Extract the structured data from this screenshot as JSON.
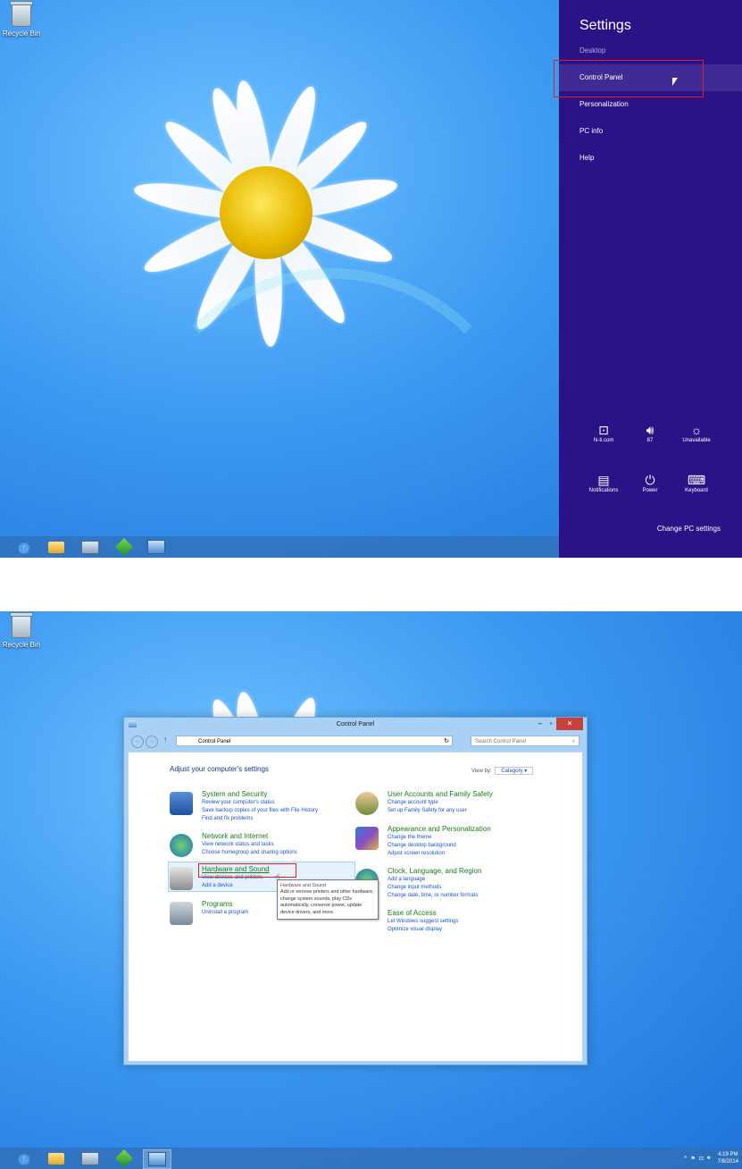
{
  "desktop": {
    "recycle_bin_label": "Recycle Bin"
  },
  "charms": {
    "title": "Settings",
    "items": [
      {
        "label": "Desktop",
        "dim": true
      },
      {
        "label": "Control Panel"
      },
      {
        "label": "Personalization"
      },
      {
        "label": "PC info"
      },
      {
        "label": "Help"
      }
    ],
    "tiles": [
      {
        "icon": "network-icon",
        "label": "hi-ti.com"
      },
      {
        "icon": "volume-icon",
        "label": "87"
      },
      {
        "icon": "brightness-icon",
        "label": "Unavailable"
      },
      {
        "icon": "notifications-icon",
        "label": "Notifications"
      },
      {
        "icon": "power-icon",
        "label": "Power"
      },
      {
        "icon": "keyboard-icon",
        "label": "Keyboard"
      }
    ],
    "change_pc_settings": "Change PC settings"
  },
  "control_panel": {
    "window_title": "Control Panel",
    "breadcrumb": "Control Panel",
    "search_placeholder": "Search Control Panel",
    "heading": "Adjust your computer's settings",
    "view_by_label": "View by:",
    "view_by_value": "Category",
    "categories": [
      {
        "title": "System and Security",
        "links": [
          "Review your computer's status",
          "Save backup copies of your files with File History",
          "Find and fix problems"
        ]
      },
      {
        "title": "Network and Internet",
        "links": [
          "View network status and tasks",
          "Choose homegroup and sharing options"
        ]
      },
      {
        "title": "Hardware and Sound",
        "links": [
          "View devices and printers",
          "Add a device"
        ]
      },
      {
        "title": "Programs",
        "links": [
          "Uninstall a program"
        ]
      },
      {
        "title": "User Accounts and Family Safety",
        "links": [
          "Change account type",
          "Set up Family Safety for any user"
        ]
      },
      {
        "title": "Appearance and Personalization",
        "links": [
          "Change the theme",
          "Change desktop background",
          "Adjust screen resolution"
        ]
      },
      {
        "title": "Clock, Language, and Region",
        "links": [
          "Add a language",
          "Change input methods",
          "Change date, time, or number formats"
        ]
      },
      {
        "title": "Ease of Access",
        "links": [
          "Let Windows suggest settings",
          "Optimize visual display"
        ]
      }
    ],
    "tooltip_title": "Hardware and Sound",
    "tooltip_text": "Add or remove printers and other hardware, change system sounds, play CDs automatically, conserve power, update device drivers, and more."
  },
  "tray": {
    "time": "4:19 PM",
    "date": "7/8/2014"
  }
}
